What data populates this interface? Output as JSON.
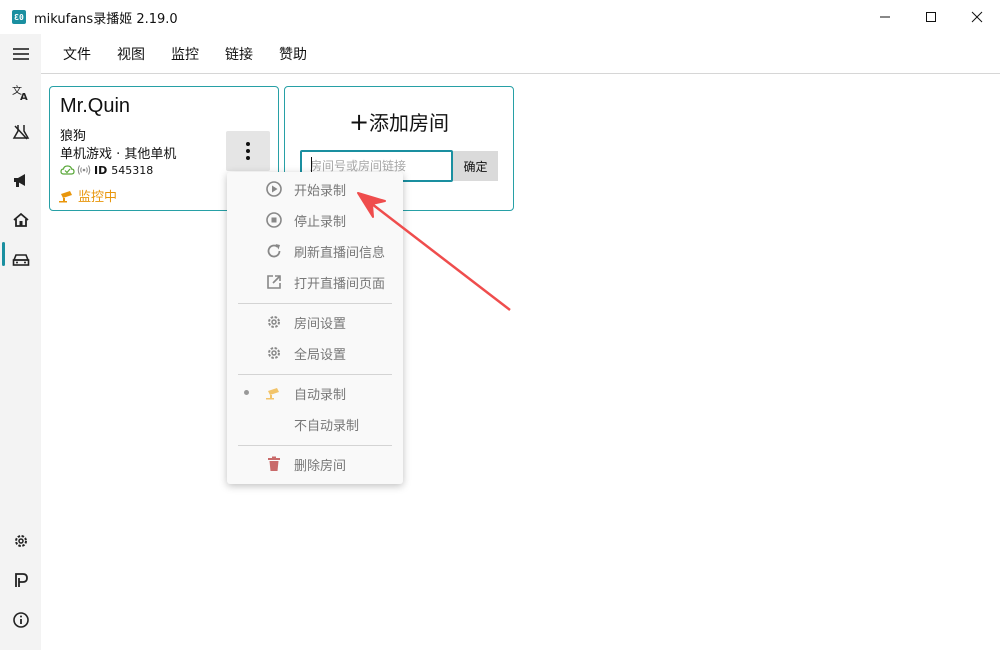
{
  "window": {
    "app_icon_text": "Ɛ0",
    "title": "mikufans录播姬 2.19.0"
  },
  "rail": {
    "items": [
      "menu-icon",
      "translate-icon",
      "lab-icon",
      "megaphone-icon",
      "home-icon",
      "car-icon",
      "gear-icon",
      "parking-icon",
      "info-icon"
    ],
    "active": "home-icon"
  },
  "menubar": {
    "items": [
      "文件",
      "视图",
      "监控",
      "链接",
      "赞助"
    ]
  },
  "room_card": {
    "name": "Mr.Quin",
    "host": "狼狗",
    "category": "单机游戏 · 其他单机",
    "id_label": "ID",
    "id_value": "545318",
    "status": "监控中"
  },
  "add_room": {
    "title": "添加房间",
    "plus": "+",
    "input_placeholder": "房间号或房间链接",
    "input_value": "",
    "confirm_label": "确定"
  },
  "context_menu": {
    "items": [
      {
        "label": "开始录制",
        "icon": "play-circle-icon"
      },
      {
        "label": "停止录制",
        "icon": "stop-circle-icon"
      },
      {
        "label": "刷新直播间信息",
        "icon": "refresh-icon"
      },
      {
        "label": "打开直播间页面",
        "icon": "open-external-icon"
      },
      {
        "label": "房间设置",
        "icon": "gear-icon"
      },
      {
        "label": "全局设置",
        "icon": "gear-icon"
      },
      {
        "label": "自动录制",
        "icon": "camera-icon"
      },
      {
        "label": "不自动录制",
        "icon": ""
      },
      {
        "label": "删除房间",
        "icon": "trash-icon"
      }
    ]
  },
  "colors": {
    "accent": "#1a8fa0",
    "card_border": "#27a0a6",
    "status": "#e8960c",
    "delete": "#c96a6a",
    "arrow": "#ef4d4d"
  }
}
